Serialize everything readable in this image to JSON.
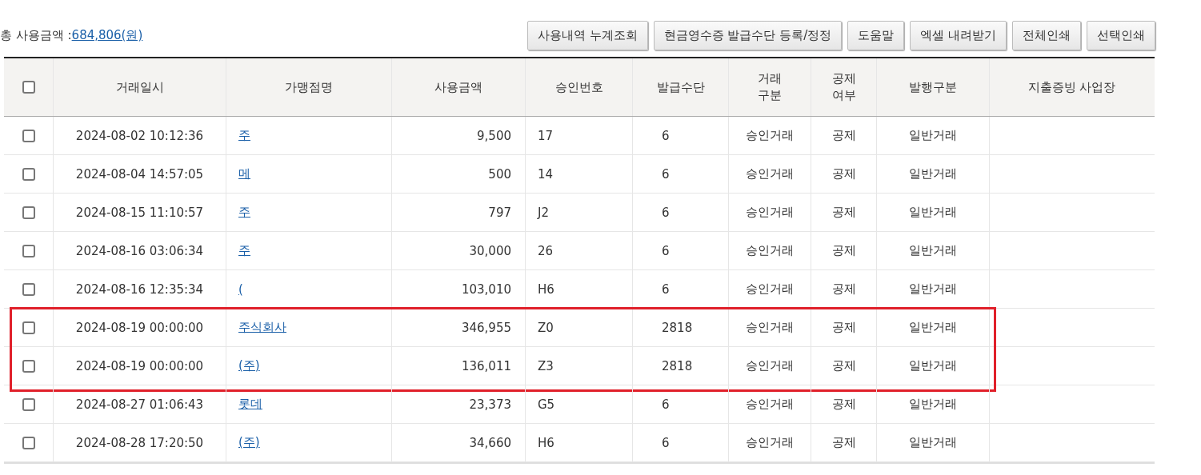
{
  "summary": {
    "label": "총 사용금액 :",
    "amount": "684,806(원)"
  },
  "buttons": [
    "사용내역 누계조회",
    "현금영수증 발급수단 등록/정정",
    "도움말",
    "엑셀 내려받기",
    "전체인쇄",
    "선택인쇄"
  ],
  "table": {
    "select_all": {
      "checked": false
    },
    "columns": [
      "거래일시",
      "가맹점명",
      "사용금액",
      "승인번호",
      "발급수단",
      "거래\n구분",
      "공제\n여부",
      "발행구분",
      "지출증빙 사업장"
    ],
    "rows": [
      {
        "checked": false,
        "highlighted": false,
        "datetime": "2024-08-02 10:12:36",
        "merchant": "주",
        "amount": "9,500",
        "approval": "17",
        "method": "6",
        "type": "승인거래",
        "deduction": "공제",
        "issue": "일반거래"
      },
      {
        "checked": false,
        "highlighted": false,
        "datetime": "2024-08-04 14:57:05",
        "merchant": "메",
        "amount": "500",
        "approval": "14",
        "method": "6",
        "type": "승인거래",
        "deduction": "공제",
        "issue": "일반거래"
      },
      {
        "checked": false,
        "highlighted": false,
        "datetime": "2024-08-15 11:10:57",
        "merchant": "주",
        "amount": "797",
        "approval": "J2",
        "method": "6",
        "type": "승인거래",
        "deduction": "공제",
        "issue": "일반거래"
      },
      {
        "checked": false,
        "highlighted": false,
        "datetime": "2024-08-16 03:06:34",
        "merchant": "주",
        "amount": "30,000",
        "approval": "26",
        "method": "6",
        "type": "승인거래",
        "deduction": "공제",
        "issue": "일반거래"
      },
      {
        "checked": false,
        "highlighted": false,
        "datetime": "2024-08-16 12:35:34",
        "merchant": "(",
        "amount": "103,010",
        "approval": "H6",
        "method": "6",
        "type": "승인거래",
        "deduction": "공제",
        "issue": "일반거래"
      },
      {
        "checked": false,
        "highlighted": true,
        "datetime": "2024-08-19 00:00:00",
        "merchant": "주식회사",
        "amount": "346,955",
        "approval": "Z0",
        "method": "2818",
        "type": "승인거래",
        "deduction": "공제",
        "issue": "일반거래"
      },
      {
        "checked": false,
        "highlighted": true,
        "datetime": "2024-08-19 00:00:00",
        "merchant": "(주)",
        "amount": "136,011",
        "approval": "Z3",
        "method": "2818",
        "type": "승인거래",
        "deduction": "공제",
        "issue": "일반거래"
      },
      {
        "checked": false,
        "highlighted": false,
        "datetime": "2024-08-27 01:06:43",
        "merchant": "롯데",
        "amount": "23,373",
        "approval": "G5",
        "method": "6",
        "type": "승인거래",
        "deduction": "공제",
        "issue": "일반거래"
      },
      {
        "checked": false,
        "highlighted": false,
        "datetime": "2024-08-28 17:20:50",
        "merchant": "(주)",
        "amount": "34,660",
        "approval": "H6",
        "method": "6",
        "type": "승인거래",
        "deduction": "공제",
        "issue": "일반거래"
      }
    ]
  }
}
